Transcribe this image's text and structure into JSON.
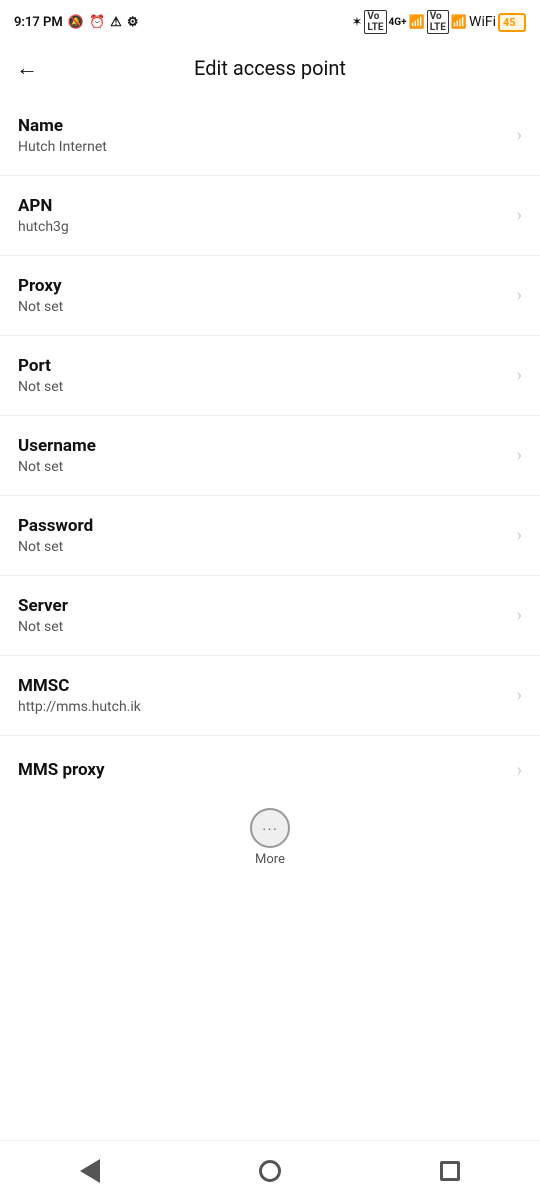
{
  "statusBar": {
    "time": "9:17 PM",
    "battery": "45"
  },
  "appBar": {
    "title": "Edit access point",
    "backLabel": "←"
  },
  "listItems": [
    {
      "label": "Name",
      "value": "Hutch Internet"
    },
    {
      "label": "APN",
      "value": "hutch3g"
    },
    {
      "label": "Proxy",
      "value": "Not set"
    },
    {
      "label": "Port",
      "value": "Not set"
    },
    {
      "label": "Username",
      "value": "Not set"
    },
    {
      "label": "Password",
      "value": "Not set"
    },
    {
      "label": "Server",
      "value": "Not set"
    },
    {
      "label": "MMSC",
      "value": "http://mms.hutch.ik"
    }
  ],
  "partialItem": {
    "label": "MMS proxy"
  },
  "more": {
    "label": "More",
    "icon": "···"
  },
  "navBar": {
    "back": "back-nav",
    "home": "home-nav",
    "recents": "recents-nav"
  }
}
